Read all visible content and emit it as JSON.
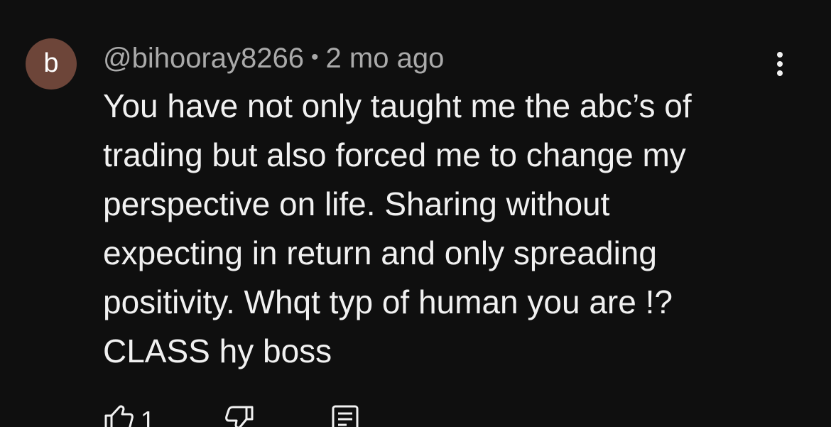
{
  "comment": {
    "avatar_letter": "b",
    "avatar_color": "#6d4539",
    "author": "@bihooray8266",
    "separator": "•",
    "time": "2 mo ago",
    "text": "You have not only taught me the abc’s of\ntrading but also forced me to change my\nperspective on life. Sharing without\nexpecting in return and only spreading\npositivity. Whqt typ of human you are !?\nCLASS hy boss",
    "like_count": "1"
  },
  "icons": {
    "more": "more-vertical-icon",
    "like": "thumbs-up-icon",
    "dislike": "thumbs-down-icon",
    "reply": "reply-comment-icon"
  }
}
